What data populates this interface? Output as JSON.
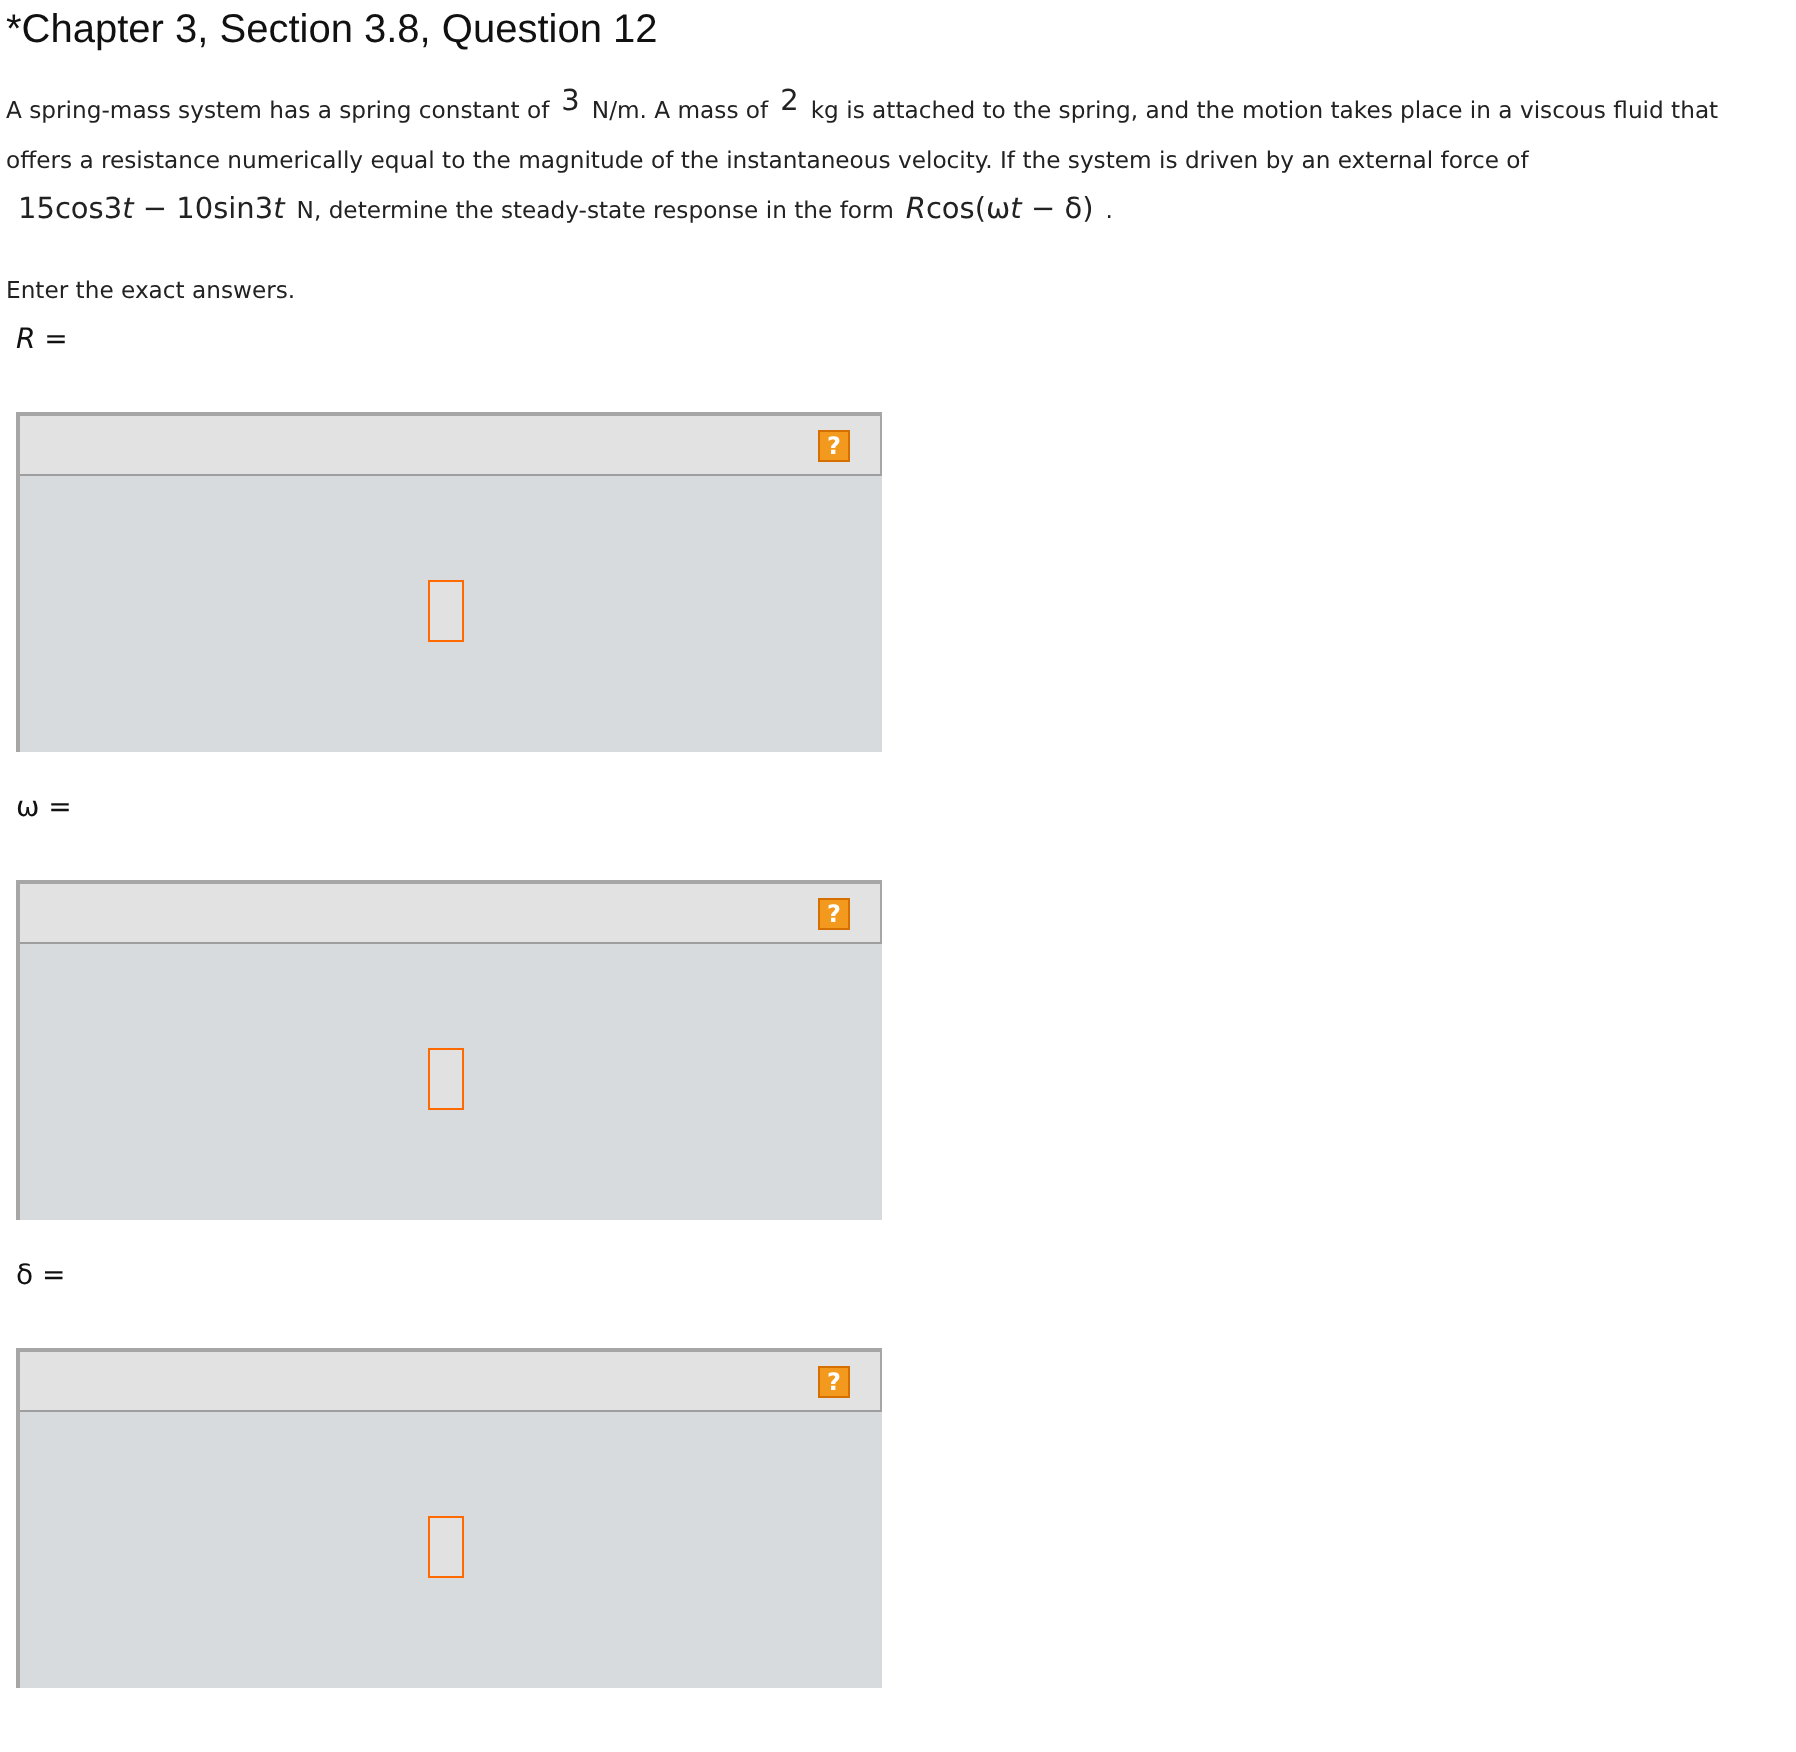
{
  "title": "*Chapter 3, Section 3.8, Question 12",
  "problem_lines": [
    [
      {
        "kind": "text",
        "text": "A spring-mass system has a spring constant of"
      },
      {
        "kind": "math",
        "text": "3"
      },
      {
        "kind": "text",
        "text": "N/m. A mass of"
      },
      {
        "kind": "math",
        "text": "2"
      },
      {
        "kind": "text",
        "text": "kg is attached to the spring, and the motion takes place in a viscous fluid that"
      }
    ],
    [
      {
        "kind": "text",
        "text": "offers a resistance numerically equal to the magnitude of the instantaneous velocity. If the system is driven by an external force of"
      }
    ],
    [
      {
        "kind": "math",
        "parts": [
          {
            "text": "15cos3",
            "italic": false
          },
          {
            "text": "t",
            "italic": true
          },
          {
            "text": " − 10sin3",
            "italic": false
          },
          {
            "text": "t",
            "italic": true
          }
        ]
      },
      {
        "kind": "text",
        "text": "N, determine the steady-state response in the form"
      },
      {
        "kind": "math",
        "parts": [
          {
            "text": "R",
            "italic": true
          },
          {
            "text": "cos(ω",
            "italic": false
          },
          {
            "text": "t",
            "italic": true
          },
          {
            "text": " − δ)",
            "italic": false
          }
        ]
      },
      {
        "kind": "text",
        "text": "."
      }
    ]
  ],
  "instruction": "Enter the exact answers.",
  "answers": [
    {
      "label": "*R* =",
      "help": "?"
    },
    {
      "label": "ω =",
      "help": "?"
    },
    {
      "label": "δ =",
      "help": "?"
    }
  ]
}
